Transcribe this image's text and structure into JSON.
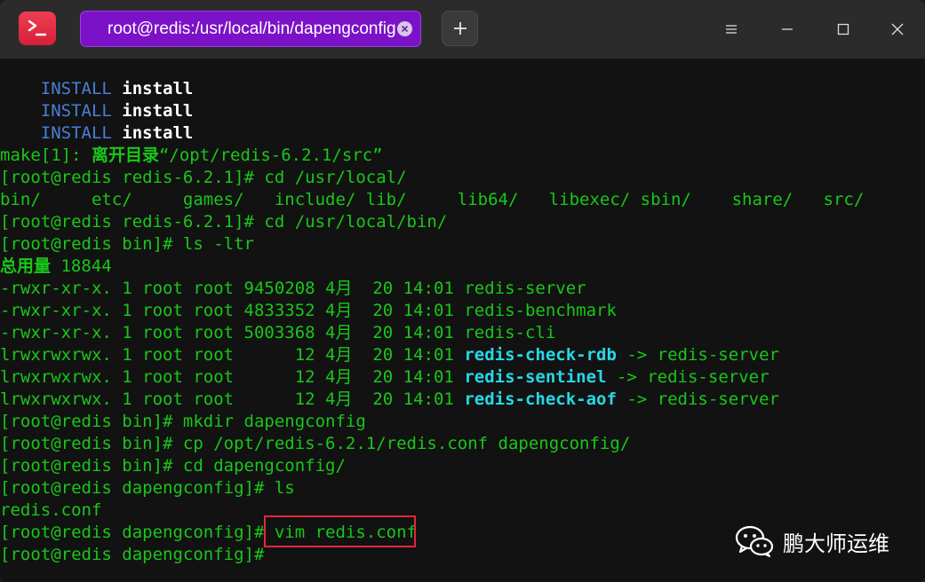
{
  "titlebar": {
    "tab_title": "root@redis:/usr/local/bin/dapengconfig",
    "new_tab_label": "+",
    "menu_icon": "hamburger-menu-icon",
    "minimize_icon": "minimize-icon",
    "maximize_icon": "maximize-icon",
    "close_icon": "close-icon"
  },
  "terminal": {
    "lines": [
      {
        "segments": [
          {
            "t": "    "
          },
          {
            "t": "INSTALL",
            "c": "c-blue"
          },
          {
            "t": " "
          },
          {
            "t": "install",
            "c": "c-white"
          }
        ]
      },
      {
        "segments": [
          {
            "t": "    "
          },
          {
            "t": "INSTALL",
            "c": "c-blue"
          },
          {
            "t": " "
          },
          {
            "t": "install",
            "c": "c-white"
          }
        ]
      },
      {
        "segments": [
          {
            "t": "    "
          },
          {
            "t": "INSTALL",
            "c": "c-blue"
          },
          {
            "t": " "
          },
          {
            "t": "install",
            "c": "c-white"
          }
        ]
      },
      {
        "segments": [
          {
            "t": "make[1]: "
          },
          {
            "t": "离开目录",
            "c": "c-bold-green"
          },
          {
            "t": "“/opt/redis-6.2.1/src”"
          }
        ]
      },
      {
        "segments": [
          {
            "t": "[root@redis redis-6.2.1]# cd /usr/local/"
          }
        ]
      },
      {
        "segments": [
          {
            "t": "bin/     etc/     games/   include/ lib/     lib64/   libexec/ sbin/    share/   src/"
          }
        ]
      },
      {
        "segments": [
          {
            "t": "[root@redis redis-6.2.1]# cd /usr/local/bin/"
          }
        ]
      },
      {
        "segments": [
          {
            "t": "[root@redis bin]# ls -ltr"
          }
        ]
      },
      {
        "segments": [
          {
            "t": "总用量",
            "c": "c-bold-green"
          },
          {
            "t": " 18844"
          }
        ]
      },
      {
        "segments": [
          {
            "t": "-rwxr-xr-x. 1 root root 9450208 4月  20 14:01 redis-server"
          }
        ]
      },
      {
        "segments": [
          {
            "t": "-rwxr-xr-x. 1 root root 4833352 4月  20 14:01 redis-benchmark"
          }
        ]
      },
      {
        "segments": [
          {
            "t": "-rwxr-xr-x. 1 root root 5003368 4月  20 14:01 redis-cli"
          }
        ]
      },
      {
        "segments": [
          {
            "t": "lrwxrwxrwx. 1 root root      12 4月  20 14:01 "
          },
          {
            "t": "redis-check-rdb",
            "c": "c-cyan"
          },
          {
            "t": " -> redis-server"
          }
        ]
      },
      {
        "segments": [
          {
            "t": "lrwxrwxrwx. 1 root root      12 4月  20 14:01 "
          },
          {
            "t": "redis-sentinel",
            "c": "c-cyan"
          },
          {
            "t": " -> redis-server"
          }
        ]
      },
      {
        "segments": [
          {
            "t": "lrwxrwxrwx. 1 root root      12 4月  20 14:01 "
          },
          {
            "t": "redis-check-aof",
            "c": "c-cyan"
          },
          {
            "t": " -> redis-server"
          }
        ]
      },
      {
        "segments": [
          {
            "t": "[root@redis bin]# mkdir dapengconfig"
          }
        ]
      },
      {
        "segments": [
          {
            "t": "[root@redis bin]# cp /opt/redis-6.2.1/redis.conf dapengconfig/"
          }
        ]
      },
      {
        "segments": [
          {
            "t": "[root@redis bin]# cd dapengconfig/"
          }
        ]
      },
      {
        "segments": [
          {
            "t": "[root@redis dapengconfig]# ls"
          }
        ]
      },
      {
        "segments": [
          {
            "t": "redis.conf"
          }
        ]
      },
      {
        "segments": [
          {
            "t": "[root@redis dapengconfig]# vim redis.conf"
          }
        ]
      },
      {
        "segments": [
          {
            "t": "[root@redis dapengconfig]#"
          }
        ]
      }
    ]
  },
  "watermark": {
    "icon": "wechat-icon",
    "text": "鹏大师运维"
  },
  "colors": {
    "terminal_green": "#19c719",
    "terminal_cyan": "#25d8e8",
    "install_blue": "#4a7ed8",
    "tab_purple": "#7c12c8",
    "highlight_red": "#e0283c"
  }
}
